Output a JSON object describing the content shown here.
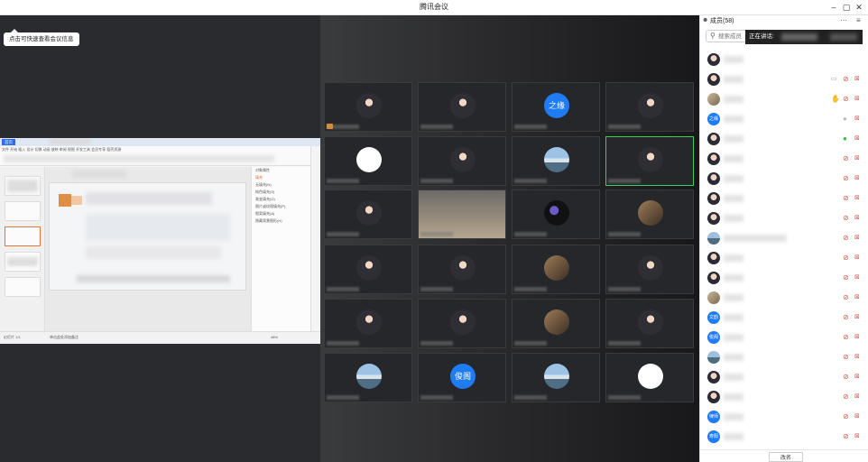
{
  "window": {
    "title": "腾讯会议",
    "min": "–",
    "max": "▢",
    "close": "✕"
  },
  "share": {
    "tip": "点击可快速查看会议信息",
    "tab_label": "首页",
    "ribbon_text": "文件  开始  插入  设计  切换  动画  放映  审阅  视图  开发工具  会员专享  稻壳资源",
    "panel_title": "对象属性",
    "panel_tab": "填充",
    "panel_rows": [
      "无填充(N)",
      "纯色填充(S)",
      "渐变填充(G)",
      "图片或纹理填充(P)",
      "图案填充(A)",
      "隐藏背景图形(H)"
    ],
    "status_left": "幻灯片 1/1",
    "status_mid": "单击此处添加备注",
    "status_zoom": "48%"
  },
  "grid": {
    "tiles": [
      {
        "avatar": "photo",
        "text": ""
      },
      {
        "avatar": "photo",
        "text": ""
      },
      {
        "avatar": "text",
        "text": "之缘"
      },
      {
        "avatar": "photo",
        "text": ""
      },
      {
        "avatar": "white",
        "text": ""
      },
      {
        "avatar": "photo",
        "text": ""
      },
      {
        "avatar": "sky",
        "text": ""
      },
      {
        "avatar": "photo",
        "text": "",
        "active": true
      },
      {
        "avatar": "photo",
        "text": ""
      },
      {
        "avatar": "room",
        "text": ""
      },
      {
        "avatar": "dark",
        "text": ""
      },
      {
        "avatar": "art",
        "text": ""
      },
      {
        "avatar": "photo",
        "text": ""
      },
      {
        "avatar": "photo",
        "text": ""
      },
      {
        "avatar": "art",
        "text": ""
      },
      {
        "avatar": "photo",
        "text": ""
      },
      {
        "avatar": "photo",
        "text": ""
      },
      {
        "avatar": "photo",
        "text": ""
      },
      {
        "avatar": "art",
        "text": ""
      },
      {
        "avatar": "photo",
        "text": ""
      },
      {
        "avatar": "sky",
        "text": ""
      },
      {
        "avatar": "text",
        "text": "俊阁"
      },
      {
        "avatar": "sky",
        "text": ""
      },
      {
        "avatar": "white",
        "text": ""
      }
    ]
  },
  "sidebar": {
    "title": "成员(58)",
    "search_placeholder": "搜索成员",
    "speaking_label": "正在讲话: ",
    "members": [
      {
        "avatar": "p1",
        "text": "",
        "mic": "",
        "cam": ""
      },
      {
        "avatar": "p1",
        "text": "",
        "mic": "off",
        "cam": "off",
        "extra": "share"
      },
      {
        "avatar": "p3",
        "text": "",
        "mic": "off",
        "cam": "off",
        "extra": "hand"
      },
      {
        "avatar": "text",
        "text": "之缘",
        "mic": "dim",
        "cam": "off"
      },
      {
        "avatar": "p1",
        "text": "",
        "mic": "on",
        "cam": "off"
      },
      {
        "avatar": "p1",
        "text": "",
        "mic": "off",
        "cam": "off"
      },
      {
        "avatar": "p1",
        "text": "",
        "mic": "off",
        "cam": "off"
      },
      {
        "avatar": "p1",
        "text": "",
        "mic": "off",
        "cam": "off"
      },
      {
        "avatar": "p1",
        "text": "",
        "mic": "off",
        "cam": "off"
      },
      {
        "avatar": "p2",
        "text": "",
        "mic": "off",
        "cam": "off"
      },
      {
        "avatar": "p1",
        "text": "",
        "mic": "off",
        "cam": "off"
      },
      {
        "avatar": "p1",
        "text": "",
        "mic": "off",
        "cam": "off"
      },
      {
        "avatar": "p3",
        "text": "",
        "mic": "off",
        "cam": "off"
      },
      {
        "avatar": "text",
        "text": "文韵",
        "mic": "off",
        "cam": "off"
      },
      {
        "avatar": "text",
        "text": "俊阁",
        "mic": "off",
        "cam": "off"
      },
      {
        "avatar": "p2",
        "text": "",
        "mic": "off",
        "cam": "off"
      },
      {
        "avatar": "p1",
        "text": "",
        "mic": "off",
        "cam": "off"
      },
      {
        "avatar": "p1",
        "text": "",
        "mic": "off",
        "cam": "off"
      },
      {
        "avatar": "text",
        "text": "律师",
        "mic": "off",
        "cam": "off"
      },
      {
        "avatar": "text",
        "text": "寿阳",
        "mic": "off",
        "cam": "off"
      }
    ],
    "footer_button": "改名"
  },
  "icons": {
    "user": "user-icon",
    "search": "search-icon",
    "mic_off": "mic-off-icon",
    "mic_on": "mic-icon",
    "cam_off": "camera-off-icon",
    "hand": "raise-hand-icon"
  }
}
